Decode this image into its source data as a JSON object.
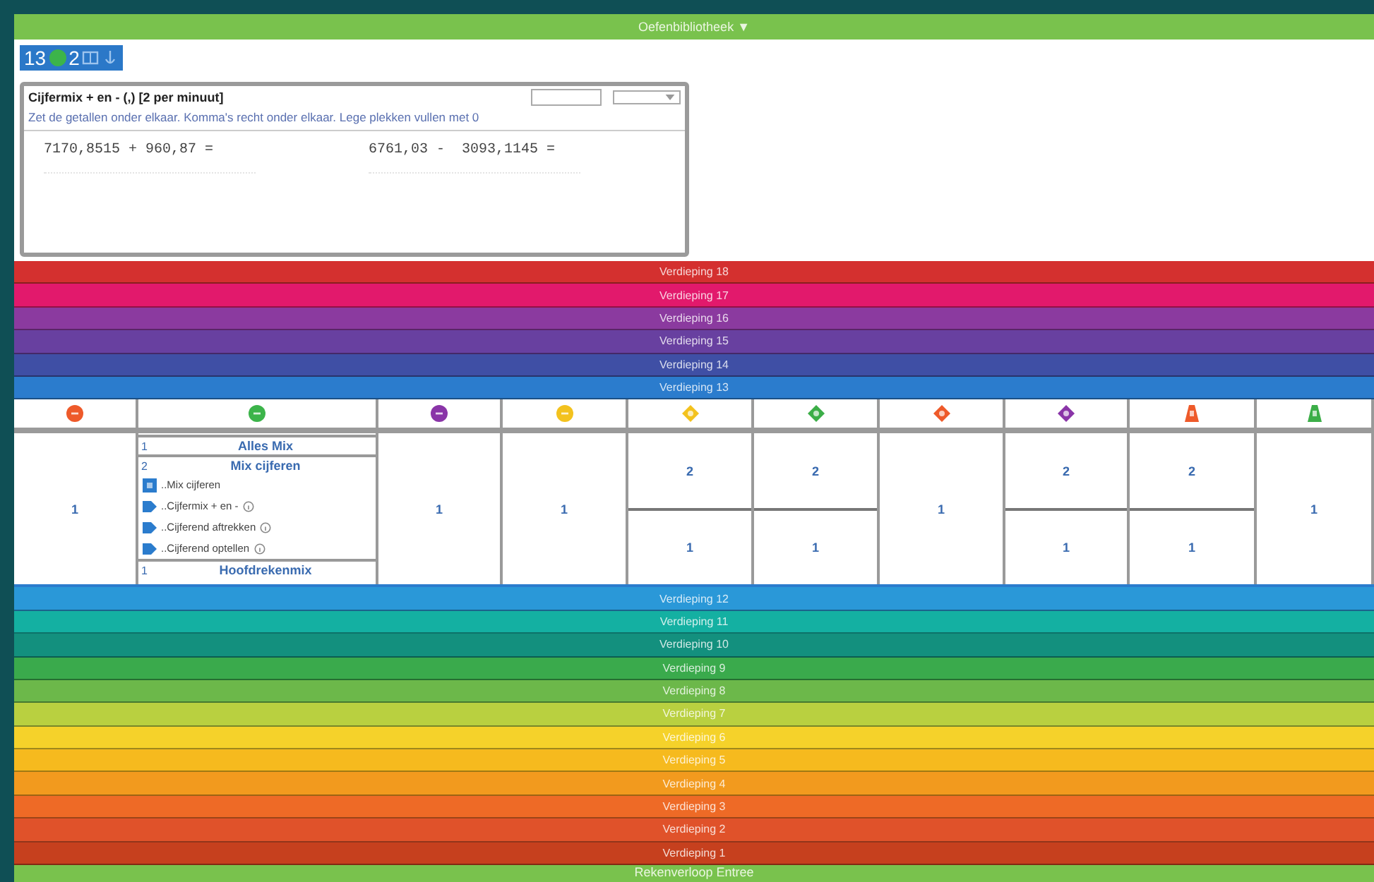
{
  "top_bar": {
    "title": "Oefenbibliotheek ▼"
  },
  "crumb": {
    "floor": "13",
    "count": "2"
  },
  "exercise": {
    "title": "Cijfermix + en - (,) [2 per minuut]",
    "instruction": "Zet de getallen onder elkaar. Komma's recht onder elkaar. Lege plekken vullen met 0",
    "problems": [
      "7170,8515 + 960,87 =",
      "6761,03 -  3093,1145 ="
    ]
  },
  "floors_upper": [
    {
      "label": "Verdieping 18",
      "color": "#d4302f"
    },
    {
      "label": "Verdieping 17",
      "color": "#e2196c"
    },
    {
      "label": "Verdieping 16",
      "color": "#8b3a9f"
    },
    {
      "label": "Verdieping 15",
      "color": "#6840a0"
    },
    {
      "label": "Verdieping 14",
      "color": "#3f4fa5"
    },
    {
      "label": "Verdieping 13",
      "color": "#2b7ccd"
    }
  ],
  "columns": [
    {
      "kind": "circle",
      "color": "#ee5a2a",
      "cells": [
        "1"
      ]
    },
    {
      "kind": "circle",
      "color": "#3cb44a",
      "entries": [
        {
          "kind": "group",
          "number": "1",
          "label": "Alles Mix"
        },
        {
          "kind": "group",
          "number": "2",
          "label": "Mix cijferen"
        },
        {
          "kind": "mix",
          "label": "..Mix cijferen",
          "info": false
        },
        {
          "kind": "exercise",
          "label": "..Cijfermix + en -",
          "info": true
        },
        {
          "kind": "exercise",
          "label": "..Cijferend aftrekken",
          "info": true
        },
        {
          "kind": "exercise",
          "label": "..Cijferend optellen",
          "info": true
        },
        {
          "kind": "group",
          "number": "1",
          "label": "Hoofdrekenmix"
        }
      ]
    },
    {
      "kind": "circle",
      "color": "#8a35a8",
      "cells": [
        "1"
      ]
    },
    {
      "kind": "circle",
      "color": "#f3c21e",
      "cells": [
        "1"
      ]
    },
    {
      "kind": "diamond",
      "color": "#f3c21e",
      "cells": [
        "2",
        "1"
      ]
    },
    {
      "kind": "diamond",
      "color": "#3cae48",
      "cells": [
        "2",
        "1"
      ]
    },
    {
      "kind": "diamond",
      "color": "#ee5a2a",
      "cells": [
        "1"
      ]
    },
    {
      "kind": "diamond",
      "color": "#8a35a8",
      "cells": [
        "2",
        "1"
      ]
    },
    {
      "kind": "bell",
      "color": "#ee5a2a",
      "cells": [
        "2",
        "1"
      ]
    },
    {
      "kind": "bell",
      "color": "#3cae48",
      "cells": [
        "1"
      ]
    }
  ],
  "floors_lower": [
    {
      "label": "Verdieping 12",
      "color": "#2a98d8"
    },
    {
      "label": "Verdieping 11",
      "color": "#14b0a2"
    },
    {
      "label": "Verdieping 10",
      "color": "#13907e"
    },
    {
      "label": "Verdieping 9",
      "color": "#3aaa4c"
    },
    {
      "label": "Verdieping 8",
      "color": "#6cb84a"
    },
    {
      "label": "Verdieping 7",
      "color": "#b9d040"
    },
    {
      "label": "Verdieping 6",
      "color": "#f5d22a"
    },
    {
      "label": "Verdieping 5",
      "color": "#f6ba1e"
    },
    {
      "label": "Verdieping 4",
      "color": "#f29a1e"
    },
    {
      "label": "Verdieping 3",
      "color": "#ee6a26"
    },
    {
      "label": "Verdieping 2",
      "color": "#e0522a"
    },
    {
      "label": "Verdieping 1",
      "color": "#c6401e"
    }
  ],
  "bottom_bar": {
    "title": "Rekenverloop Entree"
  }
}
